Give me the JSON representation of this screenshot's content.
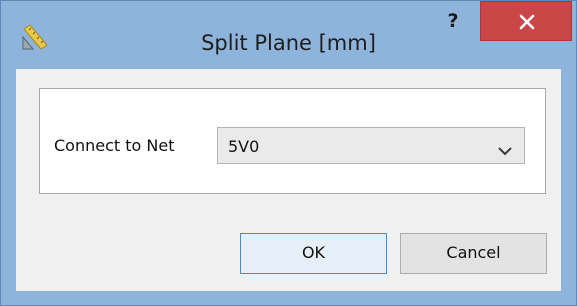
{
  "window": {
    "title": "Split Plane [mm]",
    "help_label": "?",
    "close_icon": "close-icon",
    "app_icon": "split-plane-ruler-icon"
  },
  "form": {
    "net_label": "Connect to Net",
    "net_value": "5V0",
    "dropdown_icon": "chevron-down-icon"
  },
  "buttons": {
    "ok_label": "OK",
    "cancel_label": "Cancel"
  },
  "colors": {
    "frame": "#8fb4dc",
    "close_bg": "#c94747",
    "ok_border": "#3f8fd6"
  }
}
